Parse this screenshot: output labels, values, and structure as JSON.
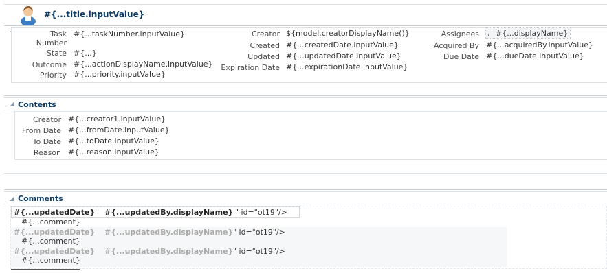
{
  "header": {
    "title": "#{...title.inputValue}",
    "avatar_icon": "user-avatar-icon"
  },
  "details": {
    "left": [
      {
        "label_line1": "Task",
        "label_line2": "Number",
        "value": "#{...taskNumber.inputValue}"
      },
      {
        "label": "State",
        "value": "#{...}"
      },
      {
        "label": "Outcome",
        "value": "#{...actionDisplayName.inputValue}"
      },
      {
        "label": "Priority",
        "value": "#{...priority.inputValue}"
      }
    ],
    "middle": [
      {
        "label": "Creator",
        "value": "${model.creatorDisplayName()}"
      },
      {
        "label": "Created",
        "value": "#{...createdDate.inputValue}"
      },
      {
        "label": "Updated",
        "value": "#{...updatedDate.inputValue}"
      },
      {
        "label": "Expiration Date",
        "value": "#{...expirationDate.inputValue}"
      }
    ],
    "right": [
      {
        "label": "Assignees",
        "value": "#{...displayName}",
        "prefix": ","
      },
      {
        "label": "Acquired By",
        "value": "#{...acquiredBy.inputValue}"
      },
      {
        "label": "Due Date",
        "value": "#{...dueDate.inputValue}"
      }
    ]
  },
  "contents": {
    "title": "Contents",
    "rows": [
      {
        "label": "Creator",
        "value": "#{...creator1.inputValue}"
      },
      {
        "label": "From Date",
        "value": "#{...fromDate.inputValue}"
      },
      {
        "label": "To Date",
        "value": "#{...toDate.inputValue}"
      },
      {
        "label": "Reason",
        "value": "#{...reason.inputValue}"
      }
    ]
  },
  "comments": {
    "title": "Comments",
    "items": [
      {
        "date": "#{...updatedDate}",
        "by": "#{...updatedBy.displayName}",
        "suffix": "' id=\"ot19\"/>",
        "comment": "#{...comment}"
      },
      {
        "date": "#{...updatedDate}",
        "by": "#{...updatedBy.displayName}",
        "suffix": "' id=\"ot19\"/>",
        "comment": "#{...comment}"
      },
      {
        "date": "#{...updatedDate}",
        "by": "#{...updatedBy.displayName}",
        "suffix": "' id=\"ot19\"/>",
        "comment": "#{...comment}"
      }
    ]
  },
  "colors": {
    "section_title": "#0b3a66",
    "border": "#c9cfd6",
    "faded_text": "#a9a9a9"
  }
}
